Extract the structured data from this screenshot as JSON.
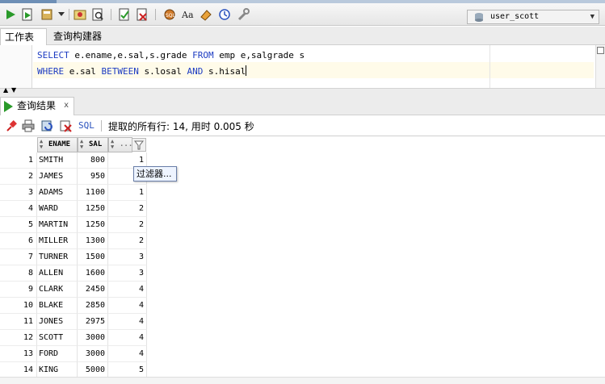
{
  "toolbar": {
    "connection": "user_scott"
  },
  "tabs": {
    "worksheet": "工作表",
    "query_builder": "查询构建器"
  },
  "editor": {
    "line1": {
      "kw1": "SELECT",
      "t1": " e.ename,e.sal,s.grade ",
      "kw2": "FROM",
      "t2": " emp e,salgrade s"
    },
    "line2": {
      "kw1": "WHERE",
      "t1": " e.sal ",
      "kw2": "BETWEEN",
      "t2": " s.losal ",
      "kw3": "AND",
      "t3": " s.hisal"
    }
  },
  "results": {
    "tab_label": "查询结果",
    "tab_close": "x",
    "sql_label": "SQL",
    "status": "提取的所有行: 14, 用时 0.005 秒",
    "columns": [
      "ENAME",
      "SAL",
      "..."
    ],
    "tooltip": "过滤器...",
    "rows": [
      {
        "rn": "1",
        "ename": "SMITH",
        "sal": "800",
        "grade": "1"
      },
      {
        "rn": "2",
        "ename": "JAMES",
        "sal": "950",
        "grade": ""
      },
      {
        "rn": "3",
        "ename": "ADAMS",
        "sal": "1100",
        "grade": "1"
      },
      {
        "rn": "4",
        "ename": "WARD",
        "sal": "1250",
        "grade": "2"
      },
      {
        "rn": "5",
        "ename": "MARTIN",
        "sal": "1250",
        "grade": "2"
      },
      {
        "rn": "6",
        "ename": "MILLER",
        "sal": "1300",
        "grade": "2"
      },
      {
        "rn": "7",
        "ename": "TURNER",
        "sal": "1500",
        "grade": "3"
      },
      {
        "rn": "8",
        "ename": "ALLEN",
        "sal": "1600",
        "grade": "3"
      },
      {
        "rn": "9",
        "ename": "CLARK",
        "sal": "2450",
        "grade": "4"
      },
      {
        "rn": "10",
        "ename": "BLAKE",
        "sal": "2850",
        "grade": "4"
      },
      {
        "rn": "11",
        "ename": "JONES",
        "sal": "2975",
        "grade": "4"
      },
      {
        "rn": "12",
        "ename": "SCOTT",
        "sal": "3000",
        "grade": "4"
      },
      {
        "rn": "13",
        "ename": "FORD",
        "sal": "3000",
        "grade": "4"
      },
      {
        "rn": "14",
        "ename": "KING",
        "sal": "5000",
        "grade": "5"
      }
    ]
  },
  "icons": {
    "run": "run-statement-icon",
    "run_script": "run-script-icon",
    "accent_green": "#2a9a2a",
    "keyword_color": "#1c3bc2"
  }
}
